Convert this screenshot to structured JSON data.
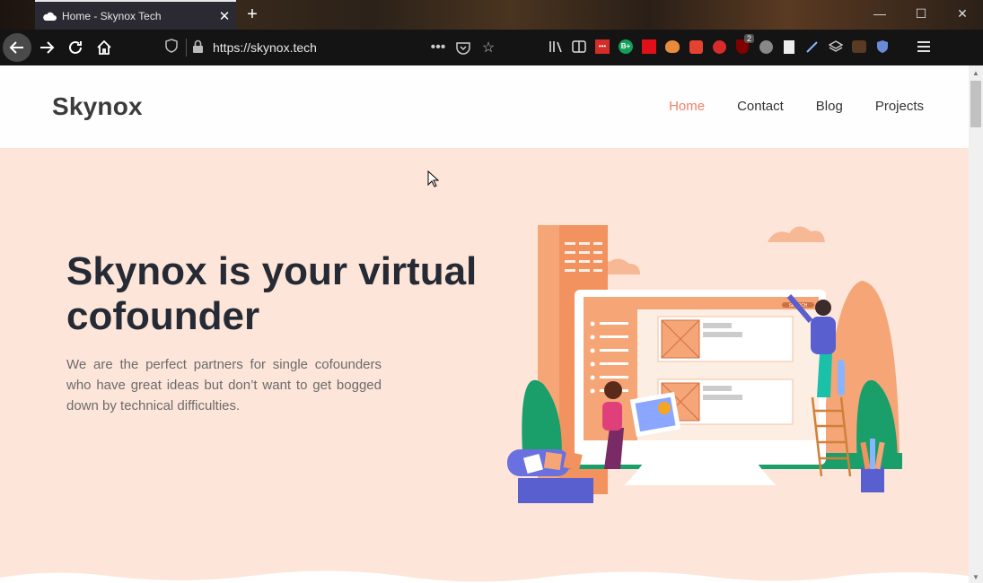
{
  "browser": {
    "tab_title": "Home - Skynox Tech",
    "url": "https://skynox.tech",
    "extension_badge": "2",
    "extensions": [
      "library-icon",
      "reader-view-icon",
      "lastpass-icon",
      "grammarly-icon",
      "pocket-red-icon",
      "owl-icon",
      "todoist-icon",
      "tomato-icon",
      "ublock-icon",
      "account-icon",
      "notes-icon",
      "pen-icon",
      "layers-icon",
      "fox-icon",
      "shield-ext-icon"
    ]
  },
  "site": {
    "logo": "Skynox",
    "menu": [
      "Home",
      "Contact",
      "Blog",
      "Projects"
    ],
    "active_menu": "Home",
    "hero_title": "Skynox is your virtual cofounder",
    "hero_text": "We are the perfect partners for single cofounders who have great ideas but don’t want to get bogged down by technical difficulties.",
    "illustration": {
      "search_label": "SEARCH"
    }
  },
  "colors": {
    "accent": "#f4806a",
    "hero_bg": "#fde6d9",
    "title": "#252a34"
  }
}
